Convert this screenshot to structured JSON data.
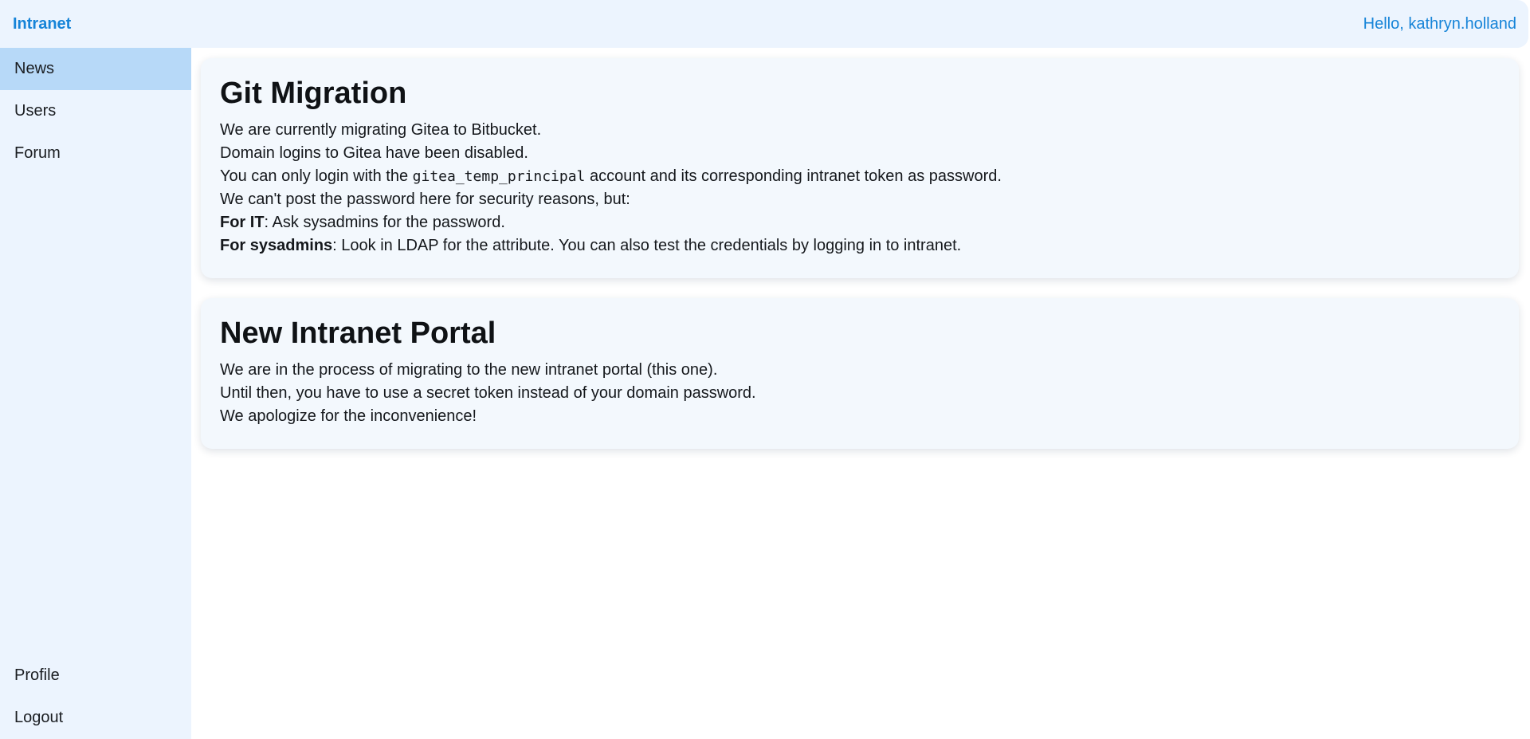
{
  "header": {
    "brand": "Intranet",
    "greeting": "Hello, kathryn.holland"
  },
  "sidebar": {
    "items": [
      {
        "label": "News"
      },
      {
        "label": "Users"
      },
      {
        "label": "Forum"
      }
    ],
    "bottom_items": [
      {
        "label": "Profile"
      },
      {
        "label": "Logout"
      }
    ],
    "active_index": 0
  },
  "colors": {
    "accent": "#1684d8",
    "sidebar_bg": "#ecf4fe",
    "active_item_bg": "#b7d9f8",
    "card_bg": "#f3f8fd"
  },
  "posts": [
    {
      "title": "Git Migration",
      "line1": "We are currently migrating Gitea to Bitbucket.",
      "line2": "Domain logins to Gitea have been disabled.",
      "line3_before": "You can only login with the ",
      "line3_code": "gitea_temp_principal",
      "line3_after": " account and its corresponding intranet token as password.",
      "line4": "We can't post the password here for security reasons, but:",
      "line5_bold": "For IT",
      "line5_rest": ": Ask sysadmins for the password.",
      "line6_bold": "For sysadmins",
      "line6_rest": ": Look in LDAP for the attribute. You can also test the credentials by logging in to intranet."
    },
    {
      "title": "New Intranet Portal",
      "line1": "We are in the process of migrating to the new intranet portal (this one).",
      "line2": "Until then, you have to use a secret token instead of your domain password.",
      "line3": "We apologize for the inconvenience!"
    }
  ]
}
